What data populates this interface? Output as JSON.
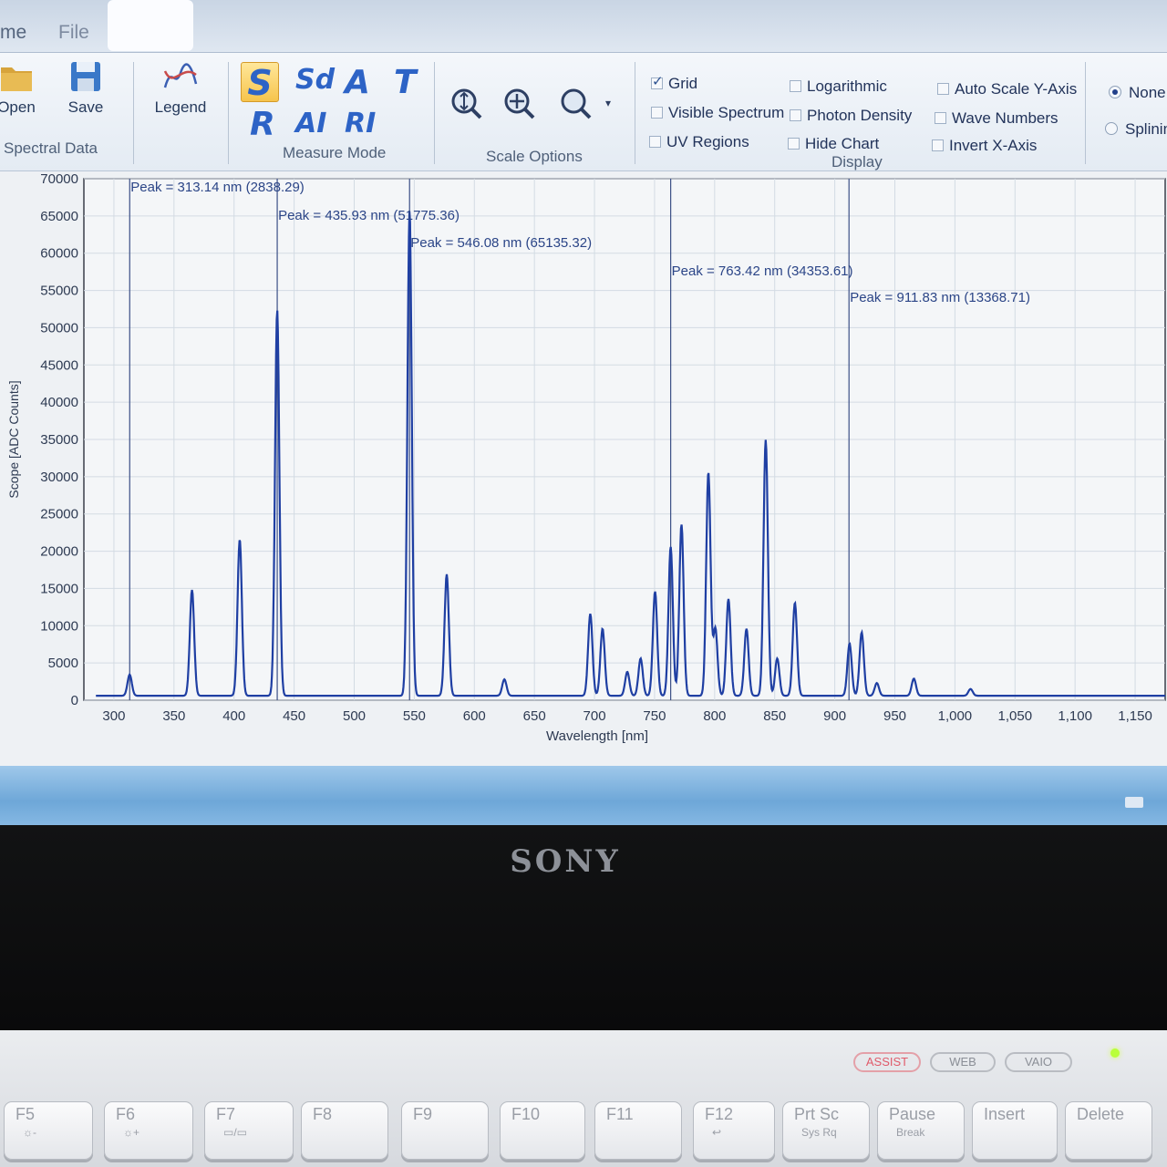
{
  "tabs": {
    "home": "me",
    "file": "File"
  },
  "ribbon": {
    "open": "Open",
    "save": "Save",
    "legend": "Legend",
    "spectral_data": "Spectral Data",
    "measure_mode": {
      "label": "Measure Mode",
      "letters": [
        "S",
        "Sd",
        "A",
        "T",
        "R",
        "AI",
        "RI"
      ],
      "active": "S"
    },
    "scale_options": "Scale Options",
    "display": {
      "label": "Display",
      "grid": "Grid",
      "visible_spectrum": "Visible Spectrum",
      "uv_regions": "UV Regions",
      "logarithmic": "Logarithmic",
      "photon_density": "Photon Density",
      "hide_chart": "Hide Chart",
      "auto_scale_y": "Auto Scale Y-Axis",
      "wave_numbers": "Wave Numbers",
      "invert_x": "Invert X-Axis",
      "grid_checked": true
    },
    "interp": {
      "none": "None",
      "spline": "Splining",
      "selected": "none"
    }
  },
  "chart_data": {
    "type": "line",
    "xlabel": "Wavelength [nm]",
    "ylabel": "Scope [ADC Counts]",
    "xlim": [
      275,
      1175
    ],
    "ylim": [
      0,
      70000
    ],
    "x_ticks": [
      300,
      350,
      400,
      450,
      500,
      550,
      600,
      650,
      700,
      750,
      800,
      850,
      900,
      950,
      1000,
      1050,
      1100,
      1150
    ],
    "x_tick_labels": [
      "300",
      "350",
      "400",
      "450",
      "500",
      "550",
      "600",
      "650",
      "700",
      "750",
      "800",
      "850",
      "900",
      "950",
      "1,000",
      "1,050",
      "1,100",
      "1,150"
    ],
    "y_ticks": [
      0,
      5000,
      10000,
      15000,
      20000,
      25000,
      30000,
      35000,
      40000,
      45000,
      50000,
      55000,
      60000,
      65000,
      70000
    ],
    "grid": true,
    "baseline": 600,
    "series": [
      {
        "color": "#1f3fa3",
        "peaks": [
          [
            313.1,
            2838
          ],
          [
            365.0,
            14200
          ],
          [
            404.7,
            21000
          ],
          [
            435.9,
            51775
          ],
          [
            546.1,
            65135
          ],
          [
            577.0,
            16300
          ],
          [
            625.0,
            2200
          ],
          [
            696.5,
            11000
          ],
          [
            706.7,
            9000
          ],
          [
            727.3,
            3200
          ],
          [
            738.4,
            5000
          ],
          [
            750.4,
            14000
          ],
          [
            763.4,
            20000
          ],
          [
            772.4,
            23000
          ],
          [
            794.8,
            30000
          ],
          [
            800.6,
            9000
          ],
          [
            811.5,
            13000
          ],
          [
            826.5,
            9000
          ],
          [
            842.5,
            34354
          ],
          [
            852.1,
            5000
          ],
          [
            866.8,
            12500
          ],
          [
            912.3,
            7000
          ],
          [
            922.4,
            8500
          ],
          [
            935.0,
            1700
          ],
          [
            965.8,
            2300
          ],
          [
            1013.0,
            900
          ]
        ]
      }
    ],
    "annotations": [
      {
        "x": 313.14,
        "text": "Peak = 313.14 nm (2838.29)"
      },
      {
        "x": 435.93,
        "text": "Peak = 435.93 nm (51775.36)"
      },
      {
        "x": 546.08,
        "text": "Peak = 546.08 nm (65135.32)"
      },
      {
        "x": 763.42,
        "text": "Peak = 763.42 nm (34353.61)"
      },
      {
        "x": 911.83,
        "text": "Peak = 911.83 nm (13368.71)"
      }
    ]
  },
  "laptop": {
    "brand": "SONY",
    "buttons": [
      "ASSIST",
      "WEB",
      "VAIO"
    ],
    "keys": [
      {
        "label": "F5",
        "sub": "☼-"
      },
      {
        "label": "F6",
        "sub": "☼+"
      },
      {
        "label": "F7",
        "sub": "▭/▭"
      },
      {
        "label": "F8",
        "sub": ""
      },
      {
        "label": "F9",
        "sub": ""
      },
      {
        "label": "F10",
        "sub": ""
      },
      {
        "label": "F11",
        "sub": ""
      },
      {
        "label": "F12",
        "sub": "↩"
      },
      {
        "label": "Prt Sc",
        "sub": "Sys Rq"
      },
      {
        "label": "Pause",
        "sub": "Break"
      },
      {
        "label": "Insert",
        "sub": ""
      },
      {
        "label": "Delete",
        "sub": ""
      }
    ]
  }
}
